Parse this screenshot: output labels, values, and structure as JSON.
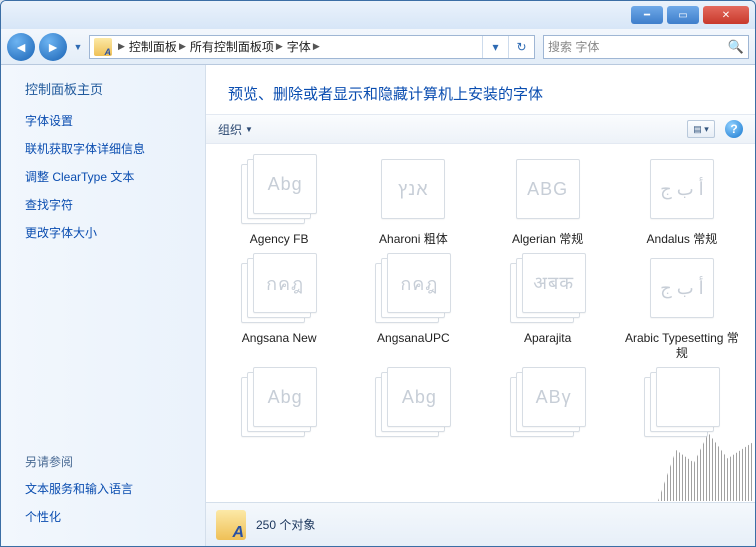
{
  "breadcrumbs": [
    "控制面板",
    "所有控制面板项",
    "字体"
  ],
  "search": {
    "placeholder": "搜索 字体"
  },
  "sidebar": {
    "home": "控制面板主页",
    "links": [
      "字体设置",
      "联机获取字体详细信息",
      "调整 ClearType 文本",
      "查找字符",
      "更改字体大小"
    ],
    "see_also_header": "另请参阅",
    "see_also": [
      "文本服务和输入语言",
      "个性化"
    ]
  },
  "heading": "预览、删除或者显示和隐藏计算机上安装的字体",
  "toolbar": {
    "organize": "组织"
  },
  "fonts": [
    {
      "name": "Agency FB",
      "sample": "Abg",
      "stack": true
    },
    {
      "name": "Aharoni 粗体",
      "sample": "אנץ",
      "stack": false
    },
    {
      "name": "Algerian 常规",
      "sample": "ABG",
      "stack": false
    },
    {
      "name": "Andalus 常规",
      "sample": "أ ب ج",
      "stack": false
    },
    {
      "name": "Angsana New",
      "sample": "กคฎ",
      "stack": true
    },
    {
      "name": "AngsanaUPC",
      "sample": "กคฎ",
      "stack": true
    },
    {
      "name": "Aparajita",
      "sample": "अबक",
      "stack": true
    },
    {
      "name": "Arabic Typesetting 常规",
      "sample": "أ ب ج",
      "stack": false
    },
    {
      "name": "",
      "sample": "Abg",
      "stack": true
    },
    {
      "name": "",
      "sample": "Abg",
      "stack": true
    },
    {
      "name": "",
      "sample": "ΑΒγ",
      "stack": true
    },
    {
      "name": "",
      "sample": "",
      "stack": true
    }
  ],
  "status": {
    "count": "250 个对象"
  }
}
